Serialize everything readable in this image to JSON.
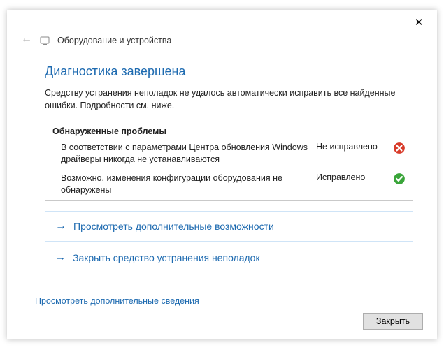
{
  "titlebar": {
    "close": "✕"
  },
  "header": {
    "back": "←",
    "title": "Оборудование и устройства"
  },
  "main": {
    "title": "Диагностика завершена",
    "subtitle": "Средству устранения неполадок не удалось автоматически исправить все найденные ошибки. Подробности см. ниже."
  },
  "problems": {
    "header": "Обнаруженные проблемы",
    "items": [
      {
        "text": "В соответствии с параметрами Центра обновления Windows драйверы никогда не устанавливаются",
        "status": "Не исправлено",
        "icon": "error"
      },
      {
        "text": "Возможно, изменения конфигурации оборудования не обнаружены",
        "status": "Исправлено",
        "icon": "ok"
      }
    ]
  },
  "actions": {
    "arrow": "→",
    "explore": "Просмотреть дополнительные возможности",
    "close_tool": "Закрыть средство устранения неполадок"
  },
  "bottom_link": "Просмотреть дополнительные сведения",
  "footer": {
    "close_btn": "Закрыть"
  }
}
